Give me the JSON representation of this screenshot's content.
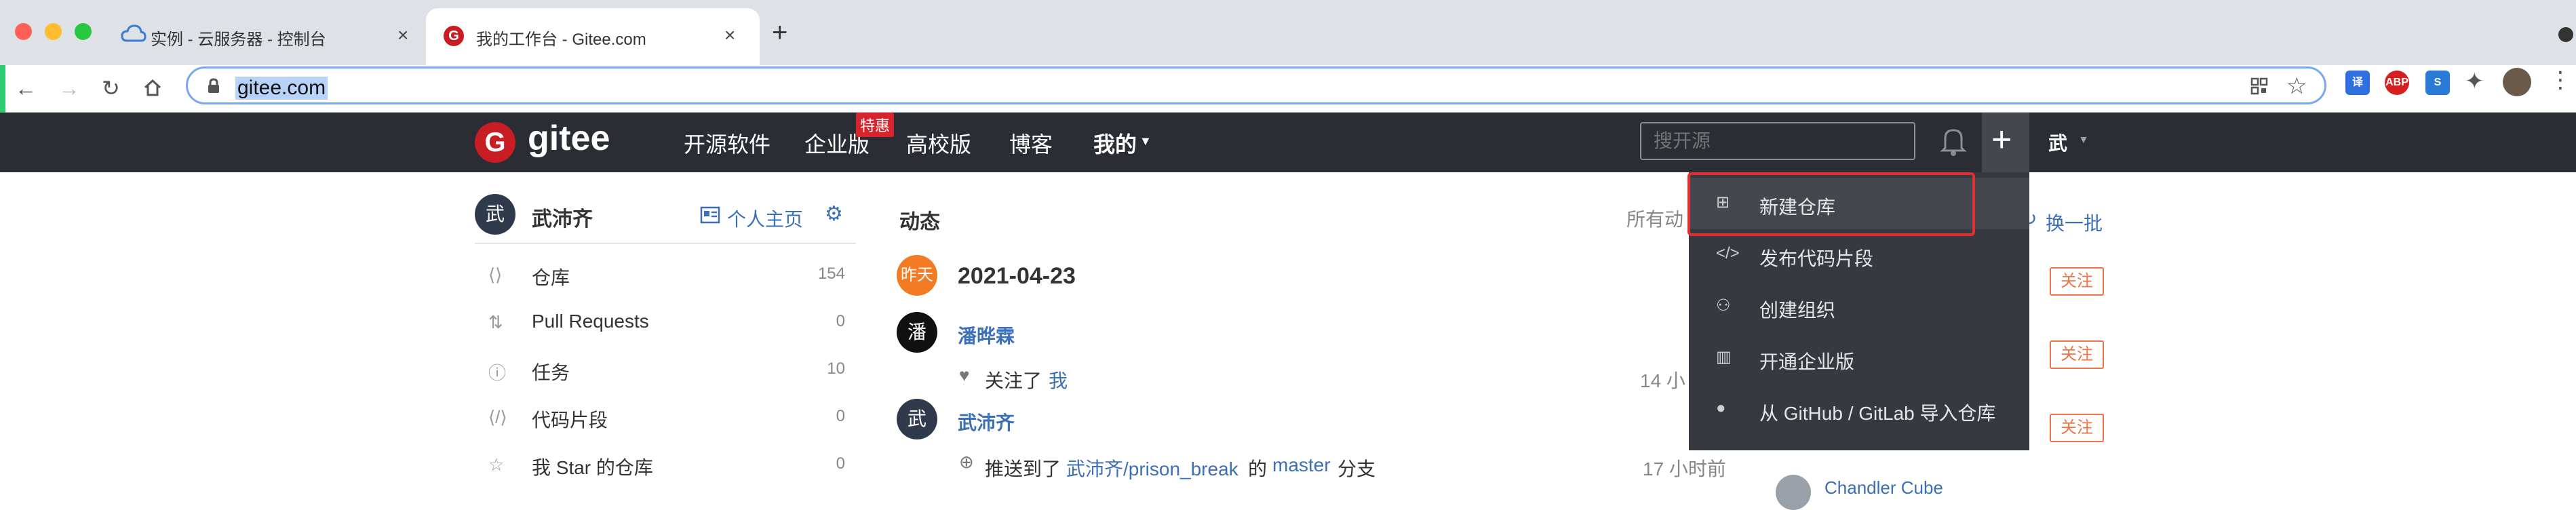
{
  "browser": {
    "tabs": [
      {
        "title": "实例 - 云服务器 - 控制台",
        "close": "×"
      },
      {
        "title": "我的工作台 - Gitee.com",
        "close": "×"
      }
    ],
    "new_tab": "+",
    "url": "gitee.com"
  },
  "header": {
    "logo_text": "gitee",
    "nav": [
      {
        "label": "开源软件"
      },
      {
        "label": "企业版",
        "badge": "特惠"
      },
      {
        "label": "高校版"
      },
      {
        "label": "博客"
      },
      {
        "label": "我的"
      }
    ],
    "search_placeholder": "搜开源",
    "plus": "+",
    "user_initial": "武"
  },
  "sidebar": {
    "user_initial": "武",
    "user_name": "武沛齐",
    "profile_link": "个人主页",
    "items": [
      {
        "label": "仓库",
        "count": "154",
        "icon": "code-icon"
      },
      {
        "label": "Pull Requests",
        "count": "0",
        "icon": "pull-request-icon"
      },
      {
        "label": "任务",
        "count": "10",
        "icon": "issue-icon"
      },
      {
        "label": "代码片段",
        "count": "0",
        "icon": "snippet-icon"
      },
      {
        "label": "我 Star 的仓库",
        "count": "0",
        "icon": "star-icon"
      }
    ]
  },
  "feed": {
    "title": "动态",
    "filter_label": "所有动",
    "day_badge": "昨天",
    "date": "2021-04-23",
    "events": [
      {
        "initial": "潘",
        "user": "潘晔霖",
        "action": "关注了",
        "target": "我",
        "time": "14 小"
      },
      {
        "initial": "武",
        "user": "武沛齐",
        "action": "推送到了",
        "repo": "武沛齐/prison_break",
        "mid": "的",
        "branch": "master",
        "suffix": "分支",
        "time": "17 小时前"
      }
    ]
  },
  "recommend": {
    "refresh_label": "换一批",
    "follow_label": "关注",
    "partial_name": "Chandler Cube"
  },
  "dropdown": {
    "items": [
      {
        "label": "新建仓库",
        "icon": "new-repo-icon"
      },
      {
        "label": "发布代码片段",
        "icon": "code-snippet-icon"
      },
      {
        "label": "创建组织",
        "icon": "organization-icon"
      },
      {
        "label": "开通企业版",
        "icon": "enterprise-icon"
      },
      {
        "label": "从 GitHub / GitLab 导入仓库",
        "icon": "github-icon"
      }
    ]
  },
  "colors": {
    "header_bg": "#2a2d33",
    "brand_red": "#c71d23",
    "dropdown_bg": "#363940",
    "highlight": "#e02f2f",
    "follow": "#f0744a"
  }
}
